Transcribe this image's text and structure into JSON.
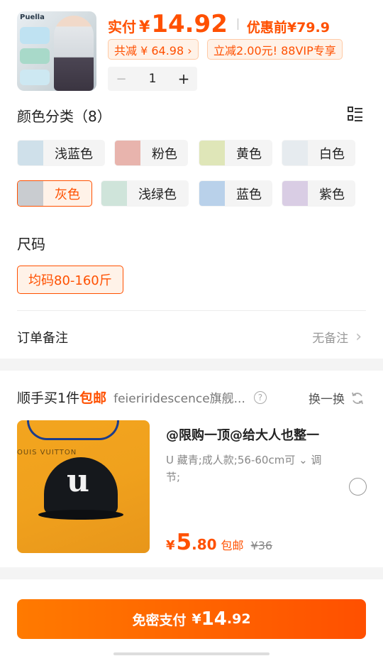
{
  "product": {
    "thumb_brand": "Puella",
    "price_label": "实付",
    "currency": "¥",
    "price": "14.92",
    "before_label": "优惠前¥79.9",
    "save_pill": "共减 ¥ 64.98 ›",
    "vip_pill": "立减2.00元! 88VIP专享",
    "quantity": "1",
    "minus": "−",
    "plus": "+"
  },
  "color_section": {
    "title": "颜色分类（8）",
    "options": [
      {
        "label": "浅蓝色",
        "swatch": "#cfe0ea"
      },
      {
        "label": "粉色",
        "swatch": "#e8b4ad"
      },
      {
        "label": "黄色",
        "swatch": "#dfe6b8"
      },
      {
        "label": "白色",
        "swatch": "#e6ebef"
      },
      {
        "label": "灰色",
        "swatch": "#c9ccd0",
        "selected": true
      },
      {
        "label": "浅绿色",
        "swatch": "#cfe4da"
      },
      {
        "label": "蓝色",
        "swatch": "#b9d1ea"
      },
      {
        "label": "紫色",
        "swatch": "#d9cde4"
      }
    ]
  },
  "size_section": {
    "title": "尺码",
    "option": "均码80-160斤"
  },
  "note": {
    "label": "订单备注",
    "value": "无备注",
    "chevron": "›"
  },
  "addon": {
    "heading_prefix": "顺手买1件",
    "heading_ship": "包邮",
    "store": "feieriridescence旗舰...",
    "help": "?",
    "swap": "换一换",
    "image_text": "OUIS VUITTON",
    "title": "@限购一顶@给大人也整一",
    "spec": "U 藏青;成人款;56-60cm可 ⌄ 调节;",
    "yen": "¥",
    "price_int": "5",
    "price_dec": ".80",
    "ship": "包邮",
    "orig": "¥36"
  },
  "pay": {
    "label": "免密支付",
    "yen": "¥",
    "amount_int": "14",
    "amount_dec": ".92"
  },
  "colors": {
    "accent": "#ff5000",
    "accent_soft": "#fff2e8"
  }
}
